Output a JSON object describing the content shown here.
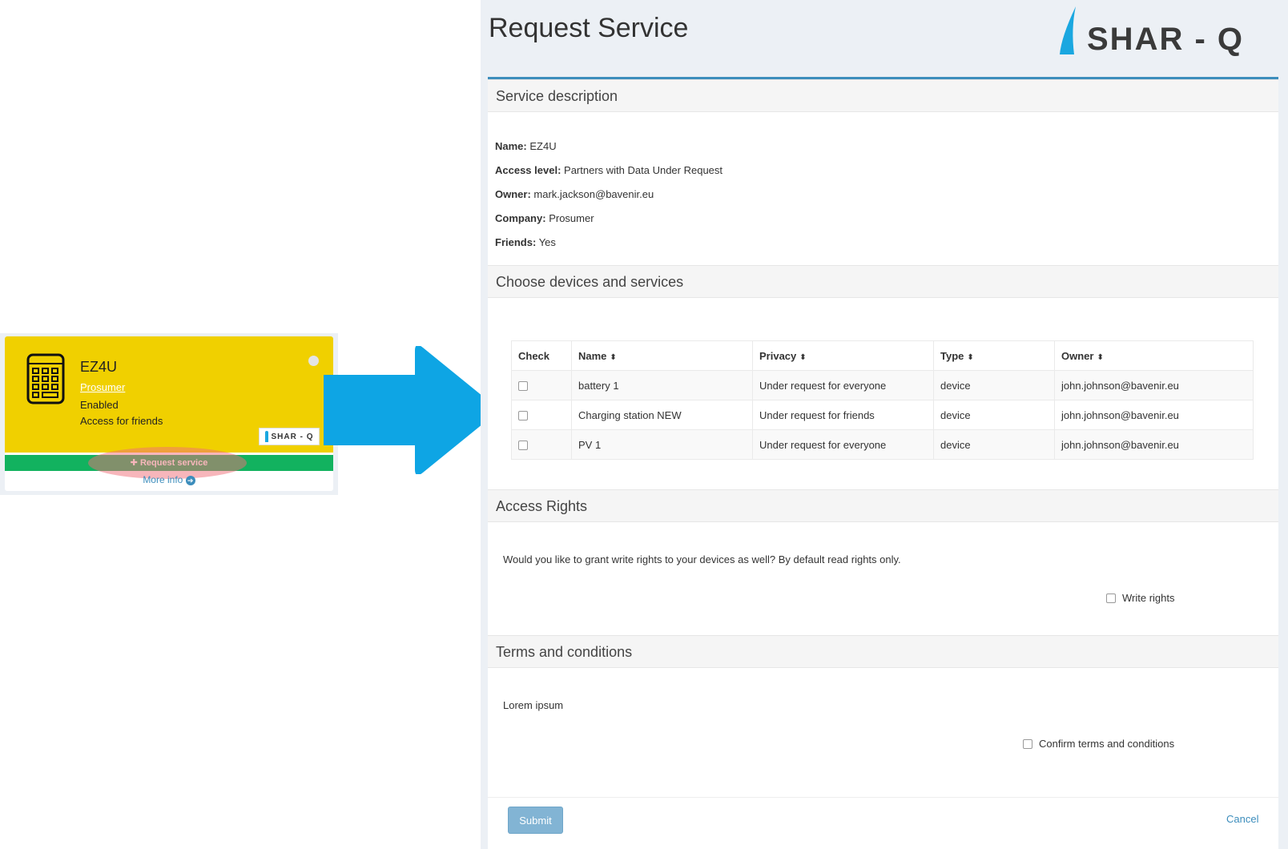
{
  "widget": {
    "title": "EZ4U",
    "company": "Prosumer",
    "status": "Enabled",
    "access": "Access for friends",
    "logo_text": "SHAR - Q",
    "request_label": "Request service",
    "more_info_label": "More info",
    "icon": "calculator-icon"
  },
  "page": {
    "title": "Request Service",
    "brand": "SHAR - Q"
  },
  "service_description": {
    "header": "Service description",
    "fields": [
      {
        "label": "Name:",
        "value": "EZ4U"
      },
      {
        "label": "Access level:",
        "value": "Partners with Data Under Request"
      },
      {
        "label": "Owner:",
        "value": "mark.jackson@bavenir.eu"
      },
      {
        "label": "Company:",
        "value": "Prosumer"
      },
      {
        "label": "Friends:",
        "value": "Yes"
      }
    ]
  },
  "devices": {
    "header": "Choose devices and services",
    "columns": [
      "Check",
      "Name",
      "Privacy",
      "Type",
      "Owner"
    ],
    "rows": [
      {
        "name": "battery 1",
        "privacy": "Under request for everyone",
        "type": "device",
        "owner": "john.johnson@bavenir.eu"
      },
      {
        "name": "Charging station NEW",
        "privacy": "Under request for friends",
        "type": "device",
        "owner": "john.johnson@bavenir.eu"
      },
      {
        "name": "PV 1",
        "privacy": "Under request for everyone",
        "type": "device",
        "owner": "john.johnson@bavenir.eu"
      }
    ]
  },
  "access_rights": {
    "header": "Access Rights",
    "text": "Would you like to grant write rights to your devices as well? By default read rights only.",
    "checkbox_label": "Write rights"
  },
  "terms": {
    "header": "Terms and conditions",
    "text": "Lorem ipsum",
    "checkbox_label": "Confirm terms and conditions"
  },
  "actions": {
    "submit_label": "Submit",
    "cancel_label": "Cancel"
  },
  "colors": {
    "card_yellow": "#f0d000",
    "request_green": "#12b25f",
    "arrow_blue": "#0ea5e4",
    "accent_blue": "#3c8dbc"
  }
}
